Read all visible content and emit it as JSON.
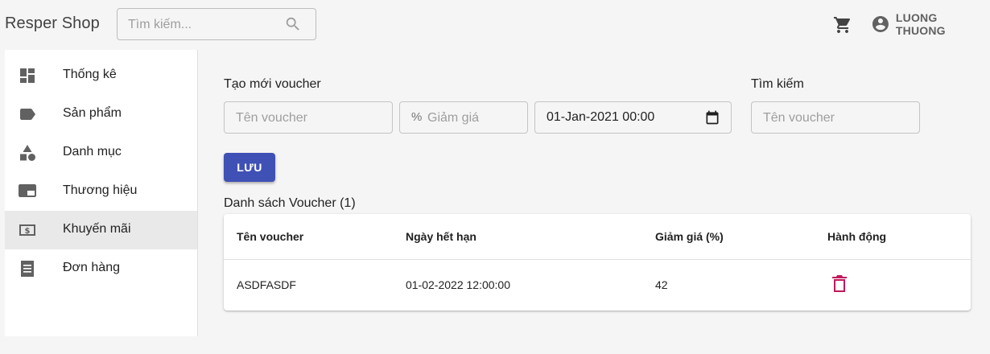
{
  "header": {
    "brand": "Resper Shop",
    "search_placeholder": "Tìm kiếm...",
    "user_name": "LUONG THUONG",
    "icons": [
      "search-icon",
      "cart-icon",
      "account-circle-icon"
    ]
  },
  "sidebar": {
    "items": [
      {
        "label": "Thống kê",
        "icon": "dashboard-icon",
        "active": false
      },
      {
        "label": "Sản phẩm",
        "icon": "label-icon",
        "active": false
      },
      {
        "label": "Danh mục",
        "icon": "category-icon",
        "active": false
      },
      {
        "label": "Thương hiệu",
        "icon": "featured-video-icon",
        "active": false
      },
      {
        "label": "Khuyến mãi",
        "icon": "money-icon",
        "active": true
      },
      {
        "label": "Đơn hàng",
        "icon": "receipt-icon",
        "active": false
      }
    ]
  },
  "create": {
    "title": "Tạo mới voucher",
    "name_placeholder": "Tên voucher",
    "discount_adornment": "%",
    "discount_placeholder": "Giảm giá",
    "date_value": "01-Jan-2021 00:00",
    "save_label": "LƯU"
  },
  "search": {
    "title": "Tìm kiếm",
    "placeholder": "Tên voucher"
  },
  "list": {
    "title": "Danh sách Voucher (1)",
    "columns": [
      "Tên voucher",
      "Ngày hết hạn",
      "Giảm giá (%)",
      "Hành động"
    ],
    "rows": [
      {
        "name": "ASDFASDF",
        "expiry": "01-02-2022 12:00:00",
        "discount": "42",
        "action_icon": "delete-icon"
      }
    ]
  },
  "colors": {
    "primary": "#3f51b5",
    "delete": "#c2185b",
    "active_nav": "#e9e9e9"
  }
}
